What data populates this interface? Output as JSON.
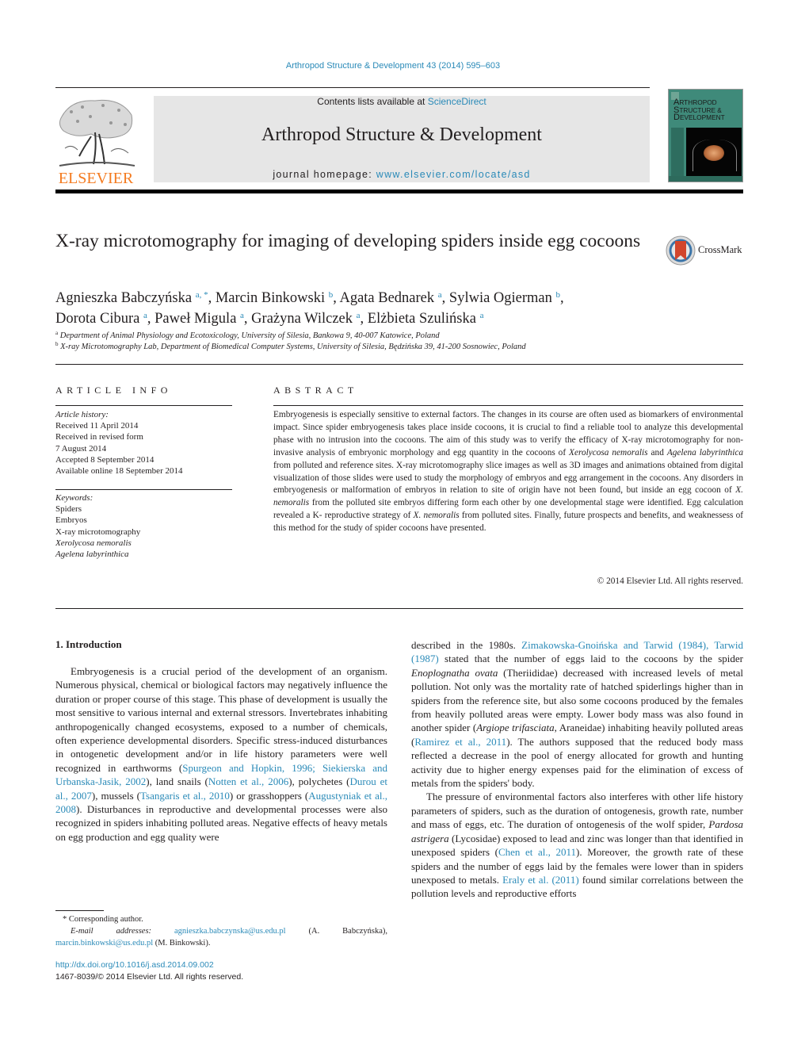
{
  "running_header": "Arthropod Structure & Development 43 (2014) 595–603",
  "masthead": {
    "publisher_logo": "ELSEVIER",
    "contents_prefix": "Contents lists available at ",
    "contents_link": "ScienceDirect",
    "journal_name": "Arthropod Structure & Development",
    "homepage_prefix": "journal homepage: ",
    "homepage_link": "www.elsevier.com/locate/asd",
    "cover": {
      "line1_initial": "A",
      "line1_rest": "RTHROPOD",
      "line2_initial": "S",
      "line2_rest": "TRUCTURE &",
      "line3_initial": "D",
      "line3_rest": "EVELOPMENT"
    }
  },
  "article": {
    "title": "X-ray microtomography for imaging of developing spiders inside egg cocoons",
    "crossmark_label": "CrossMark",
    "authors": [
      {
        "name": "Agnieszka Babczyńska",
        "sup": "a, *",
        "sep": ", "
      },
      {
        "name": "Marcin Binkowski",
        "sup": "b",
        "sep": ", "
      },
      {
        "name": "Agata Bednarek",
        "sup": "a",
        "sep": ", "
      },
      {
        "name": "Sylwia Ogierman",
        "sup": "b",
        "sep": ","
      },
      {
        "name": "Dorota Cibura",
        "sup": "a",
        "sep": ", "
      },
      {
        "name": "Paweł Migula",
        "sup": "a",
        "sep": ", "
      },
      {
        "name": "Grażyna Wilczek",
        "sup": "a",
        "sep": ", "
      },
      {
        "name": "Elżbieta Szulińska",
        "sup": "a",
        "sep": ""
      }
    ],
    "affiliations": [
      {
        "mark": "a",
        "text": "Department of Animal Physiology and Ecotoxicology, University of Silesia, Bankowa 9, 40-007 Katowice, Poland"
      },
      {
        "mark": "b",
        "text": "X-ray Microtomography Lab, Department of Biomedical Computer Systems, University of Silesia, Będzińska 39, 41-200 Sosnowiec, Poland"
      }
    ]
  },
  "article_info": {
    "heading": "ARTICLE INFO",
    "history_label": "Article history:",
    "history": [
      "Received 11 April 2014",
      "Received in revised form",
      "7 August 2014",
      "Accepted 8 September 2014",
      "Available online 18 September 2014"
    ],
    "keywords_label": "Keywords:",
    "keywords": [
      {
        "text": "Spiders",
        "italic": false
      },
      {
        "text": "Embryos",
        "italic": false
      },
      {
        "text": "X-ray microtomography",
        "italic": false
      },
      {
        "text": "Xerolycosa nemoralis",
        "italic": true
      },
      {
        "text": "Agelena labyrinthica",
        "italic": true
      }
    ]
  },
  "abstract": {
    "heading": "ABSTRACT",
    "p1": "Embryogenesis is especially sensitive to external factors. The changes in its course are often used as biomarkers of environmental impact. Since spider embryogenesis takes place inside cocoons, it is crucial to find a reliable tool to analyze this developmental phase with no intrusion into the cocoons. The aim of this study was to verify the efficacy of X-ray microtomography for non-invasive analysis of embryonic morphology and egg quantity in the cocoons of ",
    "sp1": "Xerolycosa nemoralis",
    "p2": " and ",
    "sp2": "Agelena labyrinthica",
    "p3": " from polluted and reference sites. X-ray microtomography slice images as well as 3D images and animations obtained from digital visualization of those slides were used to study the morphology of embryos and egg arrangement in the cocoons. Any disorders in embryogenesis or malformation of embryos in relation to site of origin have not been found, but inside an egg cocoon of ",
    "sp3": "X. nemoralis",
    "p4": " from the polluted site embryos differing form each other by one developmental stage were identified. Egg calculation revealed a K- reproductive strategy of ",
    "sp4": "X. nemoralis",
    "p5": " from polluted sites. Finally, future prospects and benefits, and weaknessess of this method for the study of spider cocoons have presented.",
    "copyright": "© 2014 Elsevier Ltd. All rights reserved."
  },
  "intro": {
    "heading": "1.  Introduction",
    "left": {
      "t1": "Embryogenesis is a crucial period of the development of an organism. Numerous physical, chemical or biological factors may negatively influence the duration or proper course of this stage. This phase of development is usually the most sensitive to various internal and external stressors. Invertebrates inhabiting anthropogenically changed ecosystems, exposed to a number of chemicals, often experience developmental disorders. Specific stress-induced disturbances in ontogenetic development and/or in life history parameters were well recognized in earthworms (",
      "c1": "Spurgeon and Hopkin, 1996; Siekierska and Urbanska-Jasik, 2002",
      "t2": "), land snails (",
      "c2": "Notten et al., 2006",
      "t3": "), polychetes (",
      "c3": "Durou et al., 2007",
      "t4": "), mussels (",
      "c4": "Tsangaris et al., 2010",
      "t5": ") or grasshoppers (",
      "c5": "Augustyniak et al., 2008",
      "t6": "). Disturbances in reproductive and developmental processes were also recognized in spiders inhabiting polluted areas. Negative effects of heavy metals on egg production and egg quality were"
    },
    "right": {
      "t1": "described in the 1980s. ",
      "c1": "Zimakowska-Gnoińska and Tarwid (1984), Tarwid (1987)",
      "t2": " stated that the number of eggs laid to the cocoons by the spider ",
      "i1": "Enoplognatha ovata",
      "t3": " (Theriididae) decreased with increased levels of metal pollution. Not only was the mortality rate of hatched spiderlings higher than in spiders from the reference site, but also some cocoons produced by the females from heavily polluted areas were empty. Lower body mass was also found in another spider (",
      "i2": "Argiope trifasciata",
      "t4": ", Araneidae) inhabiting heavily polluted areas (",
      "c2": "Ramirez et al., 2011",
      "t5": "). The authors supposed that the reduced body mass reflected a decrease in the pool of energy allocated for growth and hunting activity due to higher energy expenses paid for the elimination of excess of metals from the spiders' body.",
      "p2_t1": "The pressure of environmental factors also interferes with other life history parameters of spiders, such as the duration of ontogenesis, growth rate, number and mass of eggs, etc. The duration of ontogenesis of the wolf spider, ",
      "p2_i1": "Pardosa astrigera",
      "p2_t2": " (Lycosidae) exposed to lead and zinc was longer than that identified in unexposed spiders (",
      "p2_c1": "Chen et al., 2011",
      "p2_t3": "). Moreover, the growth rate of these spiders and the number of eggs laid by the females were lower than in spiders unexposed to metals. ",
      "p2_c2": "Eraly et al. (2011)",
      "p2_t4": " found similar correlations between the pollution levels and reproductive efforts"
    }
  },
  "footnotes": {
    "corresponding": "* Corresponding author.",
    "email_label": "E-mail addresses:",
    "email1": "agnieszka.babczynska@us.edu.pl",
    "email1_owner": " (A. Babczyńska), ",
    "email2": "marcin.binkowski@us.edu.pl",
    "email2_owner": " (M. Binkowski).",
    "doi": "http://dx.doi.org/10.1016/j.asd.2014.09.002",
    "issn": "1467-8039/© 2014 Elsevier Ltd. All rights reserved."
  }
}
